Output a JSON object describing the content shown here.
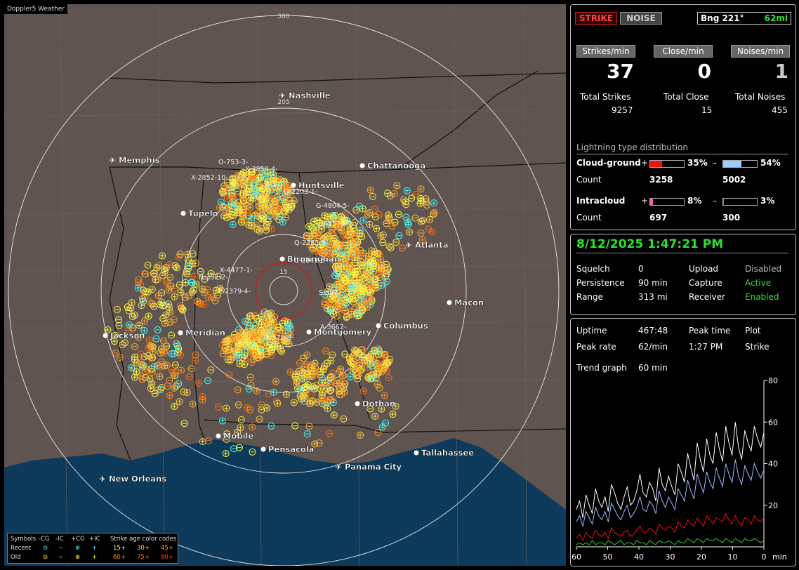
{
  "map": {
    "title": "Doppler5 Weather",
    "range_labels": [
      "300",
      "205",
      "15"
    ],
    "cities": [
      {
        "name": "Nashville",
        "type": "airport"
      },
      {
        "name": "Memphis",
        "type": "airport"
      },
      {
        "name": "Chattanooga",
        "type": "dot"
      },
      {
        "name": "Huntsville",
        "type": "dot"
      },
      {
        "name": "Tupelo",
        "type": "dot"
      },
      {
        "name": "Atlanta",
        "type": "airport"
      },
      {
        "name": "Birmingham",
        "type": "dot"
      },
      {
        "name": "Macon",
        "type": "dot"
      },
      {
        "name": "Jackson",
        "type": "dot"
      },
      {
        "name": "Meridian",
        "type": "dot"
      },
      {
        "name": "Montgomery",
        "type": "dot"
      },
      {
        "name": "Columbus",
        "type": "dot"
      },
      {
        "name": "Dothan",
        "type": "dot"
      },
      {
        "name": "Mobile",
        "type": "dot"
      },
      {
        "name": "Pensacola",
        "type": "dot"
      },
      {
        "name": "Tallahassee",
        "type": "dot"
      },
      {
        "name": "Panama City",
        "type": "airport"
      },
      {
        "name": "New Orleans",
        "type": "airport"
      }
    ],
    "cells": [
      "O-753-3-",
      "X-3858-4-",
      "X-2852-10-",
      "X-1-",
      "O-2203-1-",
      "G-4804-5-",
      "O-1576-7-",
      "Q-2285-8-",
      "C-2841-6-",
      "X-4477-1-",
      "N-352-2-",
      "P-2379-4-",
      "S-892-",
      "A-3662-",
      "A-578-3-"
    ],
    "legend": {
      "symbols_label": "Symbols",
      "cols": [
        "-CG",
        "-IC",
        "+CG",
        "+IC"
      ],
      "recent_label": "Recent",
      "old_label": "Old",
      "age_title": "Strike age color codes",
      "recent_ages": [
        "15+",
        "30+",
        "45+"
      ],
      "old_ages": [
        "60+",
        "75+",
        "90+"
      ],
      "age_colors": [
        "#ffff40",
        "#ffd040",
        "#ffa020",
        "#ff8c00",
        "#ff7010",
        "#ff5000"
      ]
    }
  },
  "top": {
    "strike_tab": "STRIKE",
    "noise_tab": "NOISE",
    "bearing": "Bng 221°",
    "distance": "62mi",
    "strikes_min_label": "Strikes/min",
    "close_min_label": "Close/min",
    "noises_min_label": "Noises/min",
    "strikes_min": "37",
    "close_min": "0",
    "noises_min": "1",
    "total_strikes_label": "Total Strikes",
    "total_close_label": "Total Close",
    "total_noises_label": "Total Noises",
    "total_strikes": "9257",
    "total_close": "15",
    "total_noises": "455",
    "dist_title": "Lightning type distribution",
    "cg_label": "Cloud-ground",
    "ic_label": "Intracloud",
    "count_label": "Count",
    "plus": "+",
    "minus": "–",
    "cg_pos_pct": "35%",
    "cg_neg_pct": "54%",
    "cg_pos_count": "3258",
    "cg_neg_count": "5002",
    "ic_pos_pct": "8%",
    "ic_neg_pct": "3%",
    "ic_pos_count": "697",
    "ic_neg_count": "300",
    "cg_pos_frac": 0.35,
    "cg_neg_frac": 0.54,
    "ic_pos_frac": 0.08,
    "ic_neg_frac": 0.03,
    "colors": {
      "cg_pos": "#ee1111",
      "cg_neg": "#99ccff",
      "ic_pos": "#ee66aa",
      "ic_neg": "#22cc22"
    }
  },
  "status": {
    "datetime": "8/12/2025 1:47:21 PM",
    "squelch_label": "Squelch",
    "squelch": "0",
    "persistence_label": "Persistence",
    "persistence": "90 min",
    "range_label": "Range",
    "range": "313 mi",
    "upload_label": "Upload",
    "upload": "Disabled",
    "capture_label": "Capture",
    "capture": "Active",
    "receiver_label": "Receiver",
    "receiver": "Enabled"
  },
  "trend": {
    "uptime_label": "Uptime",
    "uptime": "467:48",
    "peak_time_label": "Peak time",
    "peak_time": "1:27 PM",
    "plot_label": "Plot",
    "plot": "Strike",
    "peak_rate_label": "Peak rate",
    "peak_rate": "62/min",
    "trend_graph_label": "Trend graph",
    "trend_graph": "60 min",
    "x_ticks": [
      "60",
      "50",
      "40",
      "30",
      "20",
      "10",
      "0"
    ],
    "x_unit": "min",
    "y_ticks": [
      "80",
      "60",
      "40",
      "20"
    ]
  },
  "chart_data": {
    "type": "line",
    "xlabel": "min",
    "xlim": [
      60,
      0
    ],
    "ylim": [
      0,
      80
    ],
    "series": [
      {
        "values": [
          18,
          22,
          14,
          25,
          20,
          16,
          28,
          22,
          19,
          24,
          17,
          30,
          26,
          21,
          18,
          24,
          29,
          20,
          22,
          27,
          35,
          26,
          24,
          31,
          28,
          22,
          38,
          30,
          27,
          34,
          29,
          25,
          40,
          36,
          31,
          45,
          38,
          32,
          50,
          42,
          36,
          52,
          44,
          40,
          55,
          47,
          41,
          58,
          50,
          44,
          60,
          48,
          42,
          56,
          50,
          46,
          58,
          52,
          48,
          55
        ]
      },
      {
        "values": [
          12,
          15,
          10,
          17,
          14,
          11,
          19,
          15,
          13,
          17,
          12,
          21,
          18,
          15,
          13,
          17,
          20,
          14,
          16,
          19,
          24,
          18,
          17,
          22,
          20,
          16,
          27,
          22,
          19,
          24,
          21,
          18,
          28,
          25,
          22,
          32,
          27,
          23,
          35,
          30,
          26,
          36,
          31,
          28,
          38,
          33,
          29,
          40,
          35,
          31,
          42,
          34,
          30,
          39,
          35,
          32,
          40,
          36,
          33,
          37
        ]
      },
      {
        "values": [
          4,
          6,
          3,
          7,
          5,
          4,
          8,
          6,
          5,
          7,
          4,
          9,
          7,
          6,
          5,
          7,
          8,
          5,
          6,
          8,
          10,
          7,
          7,
          9,
          8,
          6,
          11,
          9,
          8,
          10,
          9,
          7,
          12,
          10,
          9,
          13,
          11,
          10,
          14,
          12,
          10,
          15,
          13,
          11,
          14,
          13,
          12,
          16,
          13,
          11,
          15,
          12,
          10,
          14,
          13,
          11,
          15,
          13,
          12,
          14
        ]
      },
      {
        "values": [
          1,
          2,
          1,
          2,
          1,
          3,
          1,
          2,
          2,
          1,
          3,
          2,
          1,
          2,
          3,
          1,
          2,
          2,
          1,
          3,
          2,
          2,
          1,
          3,
          2,
          1,
          3,
          2,
          2,
          3,
          2,
          1,
          3,
          2,
          2,
          4,
          3,
          2,
          4,
          3,
          2,
          4,
          3,
          3,
          4,
          3,
          2,
          4,
          3,
          2,
          4,
          3,
          2,
          4,
          3,
          3,
          4,
          3,
          2,
          3
        ]
      }
    ],
    "colors": [
      "#ffffff",
      "#99bbff",
      "#ee1111",
      "#33cc33"
    ]
  }
}
